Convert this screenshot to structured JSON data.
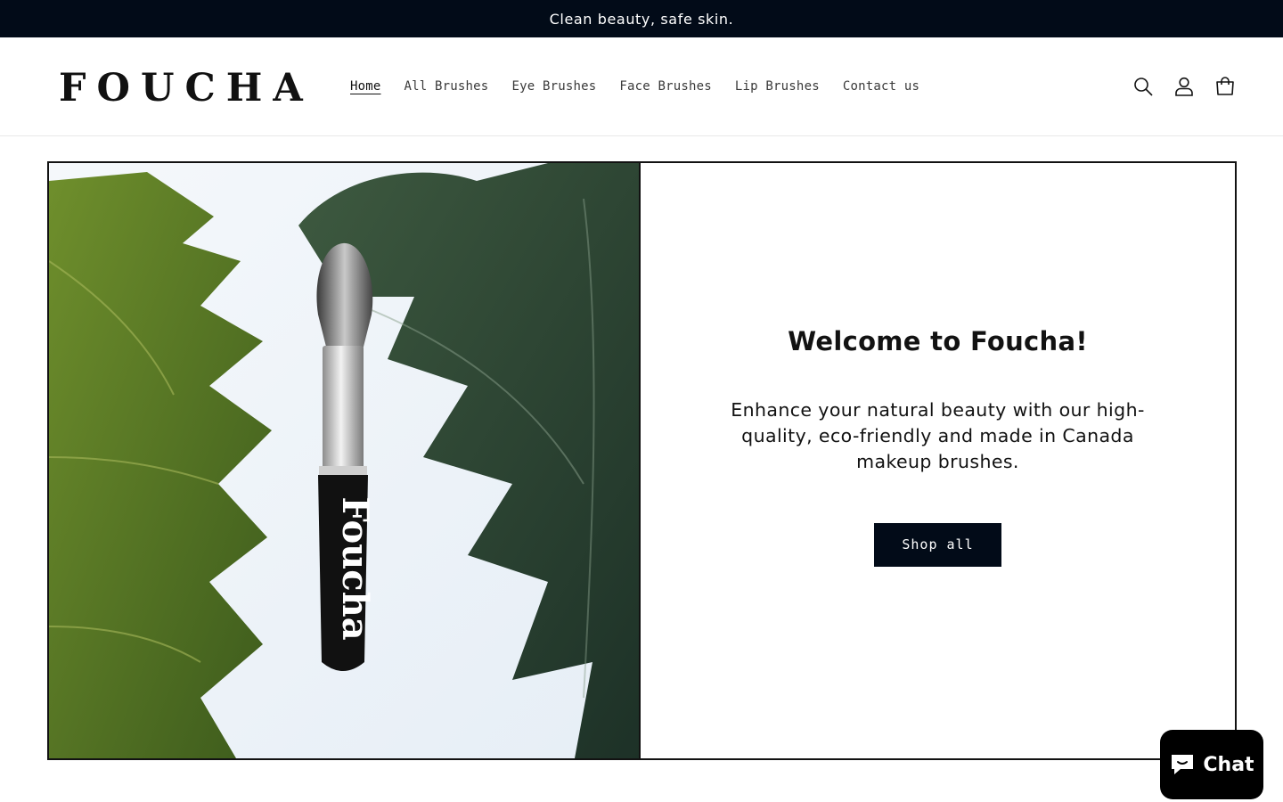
{
  "announcement": {
    "text": "Clean beauty, safe skin."
  },
  "header": {
    "logo": "FOUCHA",
    "nav": [
      {
        "label": "Home",
        "active": true
      },
      {
        "label": "All Brushes"
      },
      {
        "label": "Eye Brushes"
      },
      {
        "label": "Face Brushes"
      },
      {
        "label": "Lip Brushes"
      },
      {
        "label": "Contact us"
      }
    ],
    "icons": [
      "search-icon",
      "account-icon",
      "cart-icon"
    ]
  },
  "banner": {
    "image_brush_text": "Foucha",
    "heading_prefix": "Welcome to ",
    "heading_brand": "Foucha!",
    "text": "Enhance your natural beauty with our high-quality, eco-friendly and made in Canada makeup brushes.",
    "button": "Shop all"
  },
  "chat": {
    "label": "Chat"
  },
  "colors": {
    "dark": "#020b18",
    "leaf_light": "#5a7a24",
    "leaf_dark": "#243a2c"
  }
}
